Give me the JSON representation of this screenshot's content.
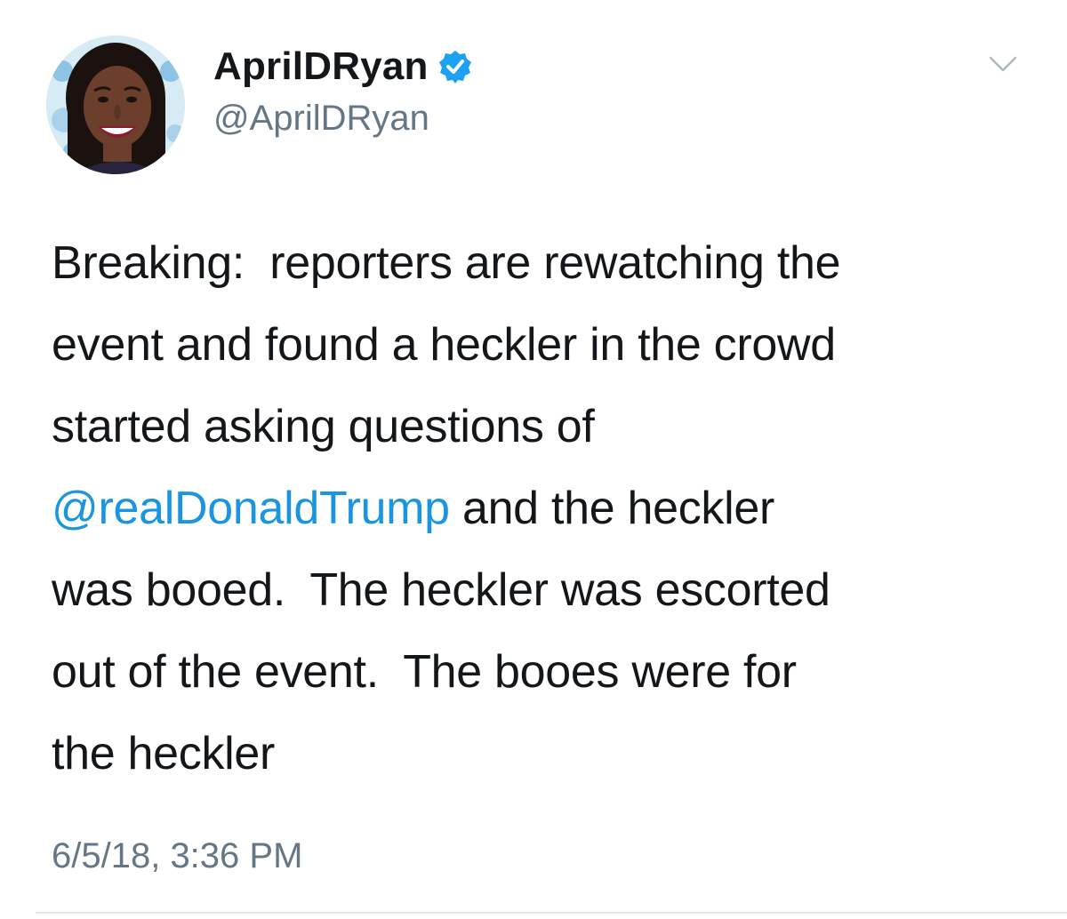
{
  "author": {
    "display_name": "AprilDRyan",
    "handle": "@AprilDRyan",
    "verified": true,
    "avatar_icon": "profile-photo"
  },
  "menu": {
    "icon": "chevron-down-icon"
  },
  "tweet": {
    "text_part1": "Breaking:  reporters are rewatching the\nevent and found a heckler in the crowd\nstarted asking questions of\n",
    "mention": "@realDonaldTrump",
    "text_part2": " and the heckler\nwas booed.  The heckler was escorted\nout of the event.  The booes were for\nthe heckler",
    "timestamp": "6/5/18, 3:36 PM"
  },
  "colors": {
    "text": "#14171a",
    "secondary": "#657786",
    "link": "#1b95e0",
    "verified": "#1da1f2",
    "divider": "#e1e8ed"
  }
}
